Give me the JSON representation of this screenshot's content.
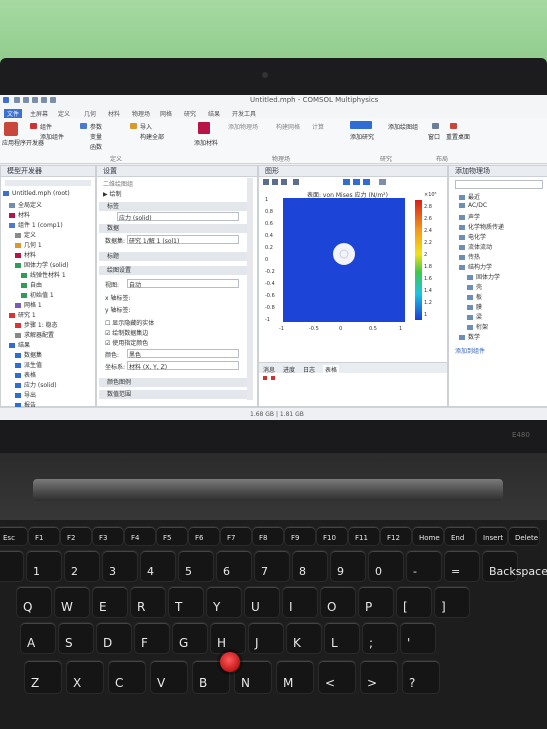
{
  "window": {
    "title": "Untitled.mph - COMSOL Multiphysics",
    "menu_items": [
      "文件",
      "主屏幕",
      "定义",
      "几何",
      "材料",
      "物理场",
      "网格",
      "研究",
      "结果",
      "开发工具"
    ]
  },
  "ribbon": {
    "groups": [
      "应用程序",
      "模型",
      "定义",
      "几何",
      "材料",
      "物理场",
      "网格",
      "研究",
      "结果",
      "布局"
    ],
    "buttons": [
      "应用程序开发器",
      "组件",
      "添加组件",
      "参数",
      "变量",
      "函数",
      "导入",
      "构建全部",
      "添加材料",
      "添加物理场",
      "构建网格",
      "计算",
      "添加研究",
      "添加绘图组",
      "窗口",
      "重置桌面"
    ]
  },
  "model_builder": {
    "title": "模型开发器",
    "tree": [
      "Untitled.mph (root)",
      "全局定义",
      "材料",
      "组件 1 (comp1)",
      "定义",
      "几何 1",
      "材料",
      "固体力学 (solid)",
      "线弹性材料 1",
      "自由",
      "初始值 1",
      "网格 1",
      "研究 1",
      "步骤 1: 稳态",
      "求解器配置",
      "结果",
      "数据集",
      "派生值",
      "表格",
      "应力 (solid)",
      "导出",
      "报告"
    ]
  },
  "settings": {
    "title": "设置",
    "subtitle": "二维绘图组",
    "sections": [
      "标签",
      "数据",
      "标题",
      "绘图设置",
      "颜色图例",
      "数值范围"
    ],
    "label_value": "应力 (solid)",
    "dataset_label": "数据集:",
    "dataset_value": "研究 1/解 1 (sol1)",
    "plot_settings_label": "视图:",
    "plot_settings_value": "自动",
    "x_axis_label": "x 轴标签:",
    "y_axis_label": "y 轴标签:",
    "checkbox_1": "显示隐藏的实体",
    "checkbox_2": "绘制数据集边",
    "checkbox_3": "使用指定颜色",
    "color_label": "颜色:",
    "color_value": "黑色",
    "frame_label": "坐标系:",
    "frame_value": "材料 (X, Y, Z)"
  },
  "graphics": {
    "title": "图形",
    "plot_title": "表面: von Mises 应力 (N/m²)",
    "tabs": [
      "消息",
      "进度",
      "日志",
      "表格"
    ],
    "x_ticks": [
      "-1",
      "-0.5",
      "0",
      "0.5",
      "1"
    ],
    "y_ticks": [
      "1",
      "0.8",
      "0.6",
      "0.4",
      "0.2",
      "0",
      "-0.2",
      "-0.4",
      "-0.6",
      "-0.8",
      "-1"
    ],
    "legend_ticks": [
      "×10⁵",
      "2.8",
      "2.6",
      "2.4",
      "2.2",
      "2",
      "1.8",
      "1.6",
      "1.4",
      "1.2",
      "1"
    ],
    "colors": {
      "field": "#1c45d8",
      "hole": "#f2f4f8"
    }
  },
  "add_physics": {
    "title": "添加物理场",
    "items": [
      "最近",
      "AC/DC",
      "声学",
      "化学物质传递",
      "电化学",
      "流体流动",
      "传热",
      "结构力学",
      "固体力学",
      "壳",
      "板",
      "膜",
      "梁",
      "桁架",
      "数学"
    ],
    "footer": "添加到组件"
  },
  "statusbar": {
    "text": "1.68 GB | 1.81 GB"
  },
  "laptop": {
    "brand": "E480"
  },
  "keyboard": {
    "row_fn": [
      "Esc",
      "F1",
      "F2",
      "F3",
      "F4",
      "F5",
      "F6",
      "F7",
      "F8",
      "F9",
      "F10",
      "F11",
      "F12",
      "Home",
      "End",
      "Insert",
      "Delete"
    ],
    "row_num_top": [
      "~",
      "!",
      "@",
      "#",
      "$",
      "%",
      "^",
      "&",
      "*",
      "(",
      ")",
      "_",
      "+",
      ""
    ],
    "row_num": [
      "`",
      "1",
      "2",
      "3",
      "4",
      "5",
      "6",
      "7",
      "8",
      "9",
      "0",
      "-",
      "=",
      "Backspace"
    ],
    "row_q": [
      "Q",
      "W",
      "E",
      "R",
      "T",
      "Y",
      "U",
      "I",
      "O",
      "P",
      "[",
      "]"
    ],
    "row_a": [
      "A",
      "S",
      "D",
      "F",
      "G",
      "H",
      "J",
      "K",
      "L",
      ";",
      "'"
    ],
    "row_z": [
      "Z",
      "X",
      "C",
      "V",
      "B",
      "N",
      "M",
      "<",
      ">",
      "?"
    ]
  }
}
